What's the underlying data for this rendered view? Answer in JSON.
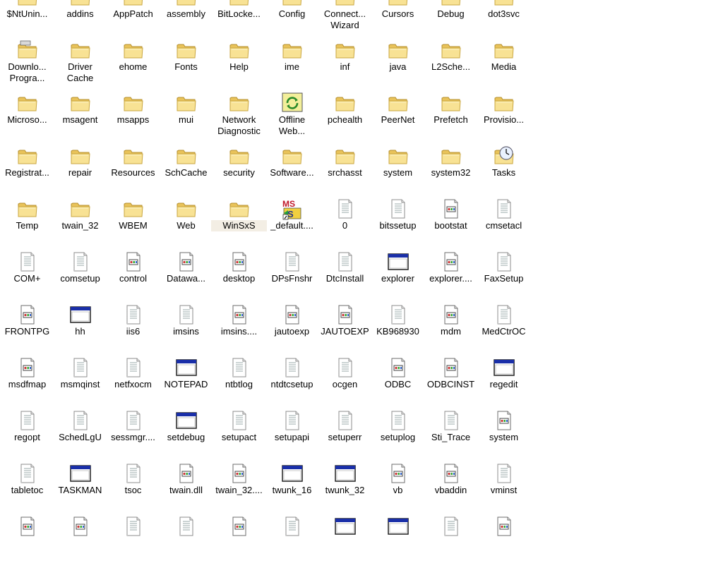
{
  "window": {
    "view": "icons",
    "folder_contents": "Windows directory"
  },
  "items": [
    {
      "label": "$NtUnin...",
      "icon": "folder-icon"
    },
    {
      "label": "addins",
      "icon": "folder-icon"
    },
    {
      "label": "AppPatch",
      "icon": "folder-icon"
    },
    {
      "label": "assembly",
      "icon": "folder-special-icon"
    },
    {
      "label": "BitLocke...",
      "icon": "folder-icon"
    },
    {
      "label": "Config",
      "icon": "folder-icon"
    },
    {
      "label": "Connect...\nWizard",
      "icon": "folder-icon"
    },
    {
      "label": "Cursors",
      "icon": "folder-icon"
    },
    {
      "label": "Debug",
      "icon": "folder-icon"
    },
    {
      "label": "dot3svc",
      "icon": "folder-icon"
    },
    {
      "label": "Downlo...\nProgra...",
      "icon": "folder-special-icon"
    },
    {
      "label": "Driver\nCache",
      "icon": "folder-icon"
    },
    {
      "label": "ehome",
      "icon": "folder-icon"
    },
    {
      "label": "Fonts",
      "icon": "folder-icon"
    },
    {
      "label": "Help",
      "icon": "folder-icon"
    },
    {
      "label": "ime",
      "icon": "folder-icon"
    },
    {
      "label": "inf",
      "icon": "folder-icon"
    },
    {
      "label": "java",
      "icon": "folder-icon"
    },
    {
      "label": "L2Sche...",
      "icon": "folder-icon"
    },
    {
      "label": "Media",
      "icon": "folder-icon"
    },
    {
      "label": "Microso...",
      "icon": "folder-icon"
    },
    {
      "label": "msagent",
      "icon": "folder-icon"
    },
    {
      "label": "msapps",
      "icon": "folder-icon"
    },
    {
      "label": "mui",
      "icon": "folder-icon"
    },
    {
      "label": "Network\nDiagnostic",
      "icon": "folder-icon"
    },
    {
      "label": "Offline\nWeb...",
      "icon": "folder-sync-icon"
    },
    {
      "label": "pchealth",
      "icon": "folder-icon"
    },
    {
      "label": "PeerNet",
      "icon": "folder-icon"
    },
    {
      "label": "Prefetch",
      "icon": "folder-icon"
    },
    {
      "label": "Provisio...",
      "icon": "folder-icon"
    },
    {
      "label": "Registrat...",
      "icon": "folder-icon"
    },
    {
      "label": "repair",
      "icon": "folder-icon"
    },
    {
      "label": "Resources",
      "icon": "folder-icon"
    },
    {
      "label": "SchCache",
      "icon": "folder-icon"
    },
    {
      "label": "security",
      "icon": "folder-icon"
    },
    {
      "label": "Software...",
      "icon": "folder-icon"
    },
    {
      "label": "srchasst",
      "icon": "folder-icon"
    },
    {
      "label": "system",
      "icon": "folder-icon"
    },
    {
      "label": "system32",
      "icon": "folder-icon"
    },
    {
      "label": "Tasks",
      "icon": "folder-clock-icon"
    },
    {
      "label": "Temp",
      "icon": "folder-icon"
    },
    {
      "label": "twain_32",
      "icon": "folder-icon"
    },
    {
      "label": "WBEM",
      "icon": "folder-icon"
    },
    {
      "label": "Web",
      "icon": "folder-icon"
    },
    {
      "label": "WinSxS",
      "icon": "folder-icon",
      "highlight": true
    },
    {
      "label": "_default....",
      "icon": "ms-logo-icon"
    },
    {
      "label": "0",
      "icon": "text-file-icon"
    },
    {
      "label": "bitssetup",
      "icon": "text-file-icon"
    },
    {
      "label": "bootstat",
      "icon": "data-file-icon"
    },
    {
      "label": "cmsetacl",
      "icon": "text-file-icon"
    },
    {
      "label": "COM+",
      "icon": "text-file-icon"
    },
    {
      "label": "comsetup",
      "icon": "text-file-icon"
    },
    {
      "label": "control",
      "icon": "data-file-icon"
    },
    {
      "label": "Datawa...",
      "icon": "data-file-icon"
    },
    {
      "label": "desktop",
      "icon": "data-file-icon"
    },
    {
      "label": "DPsFnshr",
      "icon": "text-file-icon"
    },
    {
      "label": "DtcInstall",
      "icon": "text-file-icon"
    },
    {
      "label": "explorer",
      "icon": "window-app-icon"
    },
    {
      "label": "explorer....",
      "icon": "data-file-icon"
    },
    {
      "label": "FaxSetup",
      "icon": "text-file-icon"
    },
    {
      "label": "FRONTPG",
      "icon": "data-file-icon"
    },
    {
      "label": "hh",
      "icon": "window-app-icon"
    },
    {
      "label": "iis6",
      "icon": "text-file-icon"
    },
    {
      "label": "imsins",
      "icon": "text-file-icon"
    },
    {
      "label": "imsins....",
      "icon": "data-file-icon"
    },
    {
      "label": "jautoexp",
      "icon": "data-file-icon"
    },
    {
      "label": "JAUTOEXP",
      "icon": "data-file-icon"
    },
    {
      "label": "KB968930",
      "icon": "text-file-icon"
    },
    {
      "label": "mdm",
      "icon": "data-file-icon"
    },
    {
      "label": "MedCtrOC",
      "icon": "text-file-icon"
    },
    {
      "label": "msdfmap",
      "icon": "data-file-icon"
    },
    {
      "label": "msmqinst",
      "icon": "text-file-icon"
    },
    {
      "label": "netfxocm",
      "icon": "text-file-icon"
    },
    {
      "label": "NOTEPAD",
      "icon": "window-app-icon"
    },
    {
      "label": "ntbtlog",
      "icon": "text-file-icon"
    },
    {
      "label": "ntdtcsetup",
      "icon": "text-file-icon"
    },
    {
      "label": "ocgen",
      "icon": "text-file-icon"
    },
    {
      "label": "ODBC",
      "icon": "data-file-icon"
    },
    {
      "label": "ODBCINST",
      "icon": "data-file-icon"
    },
    {
      "label": "regedit",
      "icon": "window-app-icon"
    },
    {
      "label": "regopt",
      "icon": "text-file-icon"
    },
    {
      "label": "SchedLgU",
      "icon": "text-file-icon"
    },
    {
      "label": "sessmgr....",
      "icon": "text-file-icon"
    },
    {
      "label": "setdebug",
      "icon": "window-app-icon"
    },
    {
      "label": "setupact",
      "icon": "text-file-icon"
    },
    {
      "label": "setupapi",
      "icon": "text-file-icon"
    },
    {
      "label": "setuperr",
      "icon": "text-file-icon"
    },
    {
      "label": "setuplog",
      "icon": "text-file-icon"
    },
    {
      "label": "Sti_Trace",
      "icon": "text-file-icon"
    },
    {
      "label": "system",
      "icon": "data-file-icon"
    },
    {
      "label": "tabletoc",
      "icon": "text-file-icon"
    },
    {
      "label": "TASKMAN",
      "icon": "window-app-icon"
    },
    {
      "label": "tsoc",
      "icon": "text-file-icon"
    },
    {
      "label": "twain.dll",
      "icon": "data-file-icon"
    },
    {
      "label": "twain_32....",
      "icon": "data-file-icon"
    },
    {
      "label": "twunk_16",
      "icon": "window-app-icon"
    },
    {
      "label": "twunk_32",
      "icon": "window-app-icon"
    },
    {
      "label": "vb",
      "icon": "data-file-icon"
    },
    {
      "label": "vbaddin",
      "icon": "data-file-icon"
    },
    {
      "label": "vminst",
      "icon": "text-file-icon"
    },
    {
      "label": "",
      "icon": "data-file-icon"
    },
    {
      "label": "",
      "icon": "data-file-icon"
    },
    {
      "label": "",
      "icon": "text-file-icon"
    },
    {
      "label": "",
      "icon": "text-file-icon"
    },
    {
      "label": "",
      "icon": "data-file-icon"
    },
    {
      "label": "",
      "icon": "text-file-icon"
    },
    {
      "label": "",
      "icon": "window-app-icon"
    },
    {
      "label": "",
      "icon": "window-app-icon"
    },
    {
      "label": "",
      "icon": "text-file-icon"
    },
    {
      "label": "",
      "icon": "data-file-icon"
    }
  ],
  "colors": {
    "folder_fill": "#f6dc84",
    "folder_edge": "#c9a640",
    "window_titlebar": "#1a2fa8",
    "selection_bg": "#f3eee4"
  }
}
